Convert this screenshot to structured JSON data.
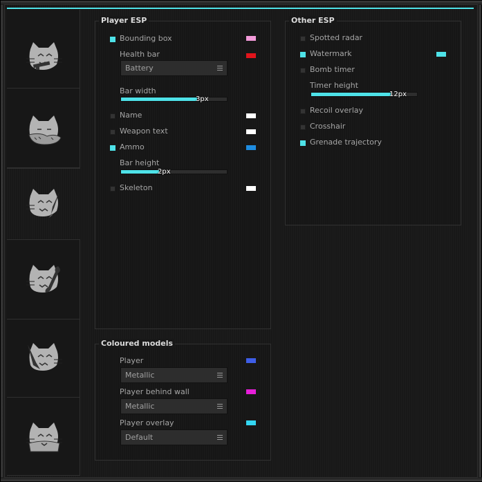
{
  "player_esp": {
    "title": "Player ESP",
    "bounding_box": {
      "label": "Bounding box",
      "checked": true,
      "color": "#f29ad9"
    },
    "health_bar": {
      "label": "Health bar",
      "color": "#e0141b",
      "style": "Battery"
    },
    "bar_width": {
      "label": "Bar width",
      "value": "3px",
      "fraction": 0.72
    },
    "name": {
      "label": "Name",
      "checked": false,
      "color": "#ffffff"
    },
    "weapon_text": {
      "label": "Weapon text",
      "checked": false,
      "color": "#ffffff"
    },
    "ammo": {
      "label": "Ammo",
      "checked": true,
      "color": "#1e8ce0"
    },
    "bar_height": {
      "label": "Bar height",
      "value": "2px",
      "fraction": 0.36
    },
    "skeleton": {
      "label": "Skeleton",
      "checked": false,
      "color": "#ffffff"
    }
  },
  "coloured_models": {
    "title": "Coloured models",
    "player": {
      "label": "Player",
      "color": "#3e5ee8",
      "material": "Metallic"
    },
    "player_behind_wall": {
      "label": "Player behind wall",
      "color": "#e61fd9",
      "material": "Metallic"
    },
    "player_overlay": {
      "label": "Player overlay",
      "color": "#33d6f2",
      "material": "Default"
    }
  },
  "other_esp": {
    "title": "Other ESP",
    "spotted_radar": {
      "label": "Spotted radar",
      "checked": false
    },
    "watermark": {
      "label": "Watermark",
      "checked": true,
      "color": "#4ee2e8"
    },
    "bomb_timer": {
      "label": "Bomb timer",
      "checked": false
    },
    "timer_height": {
      "label": "Timer height",
      "value": "12px",
      "fraction": 0.75
    },
    "recoil_overlay": {
      "label": "Recoil overlay",
      "checked": false
    },
    "crosshair": {
      "label": "Crosshair",
      "checked": false
    },
    "grenade_trajectory": {
      "label": "Grenade trajectory",
      "checked": true
    }
  },
  "sidebar": {
    "tabs": [
      {
        "icon": "cat-aim-icon",
        "active": false
      },
      {
        "icon": "cat-sleep-icon",
        "active": false
      },
      {
        "icon": "cat-paint-icon",
        "active": true
      },
      {
        "icon": "cat-wrench-icon",
        "active": false
      },
      {
        "icon": "cat-knife-icon",
        "active": false
      },
      {
        "icon": "cat-blanket-icon",
        "active": false
      }
    ]
  },
  "colors": {
    "accent": "#4ee2e8",
    "background": "#181818",
    "text": "#a6a6a6"
  }
}
